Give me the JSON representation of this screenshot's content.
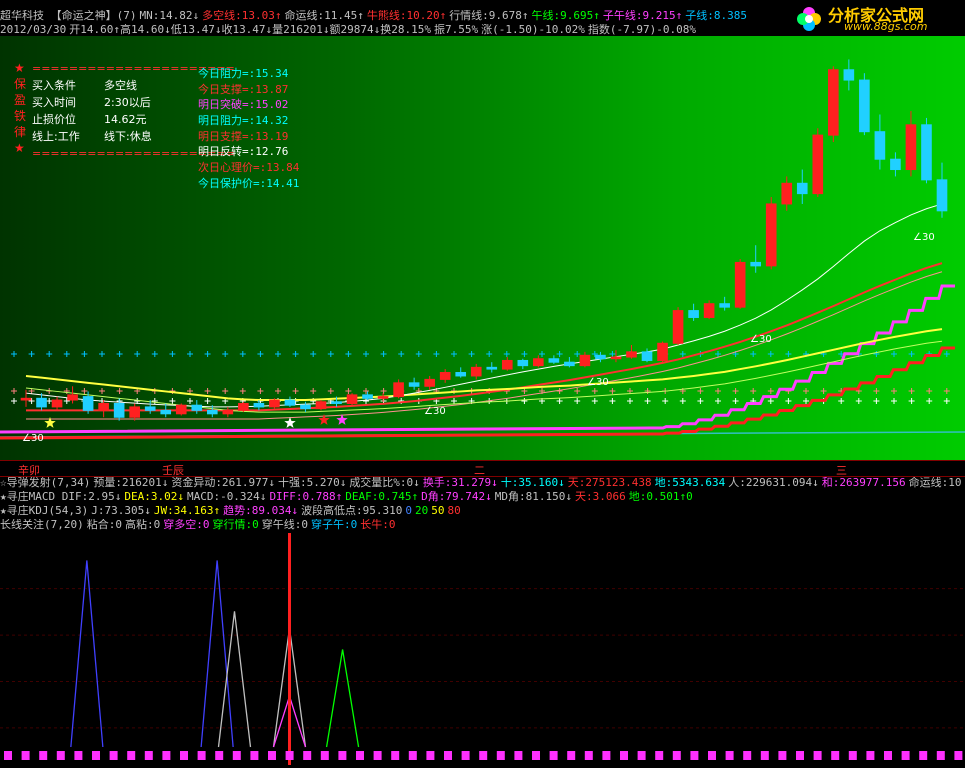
{
  "header": {
    "row1": [
      {
        "t": "超华科技 【命运之神】(7)",
        "c": "#c0c0c0"
      },
      {
        "t": "MN:14.82↓",
        "c": "#c0c0c0"
      },
      {
        "t": "多空线:13.03↑",
        "c": "#ff3030"
      },
      {
        "t": "命运线:11.45↑",
        "c": "#c0c0c0"
      },
      {
        "t": "牛熊线:10.20↑",
        "c": "#ff3030"
      },
      {
        "t": "行情线:9.678↑",
        "c": "#c0c0c0"
      },
      {
        "t": "午线:9.695↑",
        "c": "#00ff00"
      },
      {
        "t": "子午线:9.215↑",
        "c": "#ff40ff"
      },
      {
        "t": "子线:8.385",
        "c": "#00c0ff"
      }
    ],
    "row2": [
      {
        "t": "2012/03/30",
        "c": "#c0c0c0"
      },
      {
        "t": "开14.60↑高14.60↓低13.47↓收13.47↓量216201↓额29874↓换28.15%",
        "c": "#c0c0c0"
      },
      {
        "t": "振7.55%",
        "c": "#c0c0c0"
      },
      {
        "t": "涨(-1.50)-10.02%",
        "c": "#c0c0c0"
      },
      {
        "t": "指数(-7.97)-0.08%",
        "c": "#c0c0c0"
      }
    ]
  },
  "logo": {
    "title": "分析家公式网",
    "url": "www.88gs.com"
  },
  "info_panel": {
    "side_chars": [
      "★",
      "保",
      "盈",
      "铁",
      "律",
      "★"
    ],
    "lines": [
      {
        "a": "======================",
        "b": "",
        "c": "#ff3030"
      },
      {
        "a": "买入条件",
        "b": "多空线",
        "c": "#ffffff"
      },
      {
        "a": "买入时间",
        "b": "2:30以后",
        "c": "#ffffff"
      },
      {
        "a": "止损价位",
        "b": "14.62元",
        "c": "#ffffff"
      },
      {
        "a": "线上:工作",
        "b": "线下:休息",
        "c": "#ffffff"
      },
      {
        "a": "======================",
        "b": "",
        "c": "#ff3030"
      }
    ]
  },
  "levels": [
    {
      "t": "今日阻力=:15.34",
      "c": "#00ffff"
    },
    {
      "t": "今日支撑=:13.87",
      "c": "#ff3030"
    },
    {
      "t": "明日突破=:15.02",
      "c": "#ff40ff"
    },
    {
      "t": "明日阻力=:14.32",
      "c": "#00ffff"
    },
    {
      "t": "明日支撑=:13.19",
      "c": "#ff3030"
    },
    {
      "t": "明日反转=:12.76",
      "c": "#ffffff"
    },
    {
      "t": "次日心理价=:13.84",
      "c": "#ff3030"
    },
    {
      "t": "今日保护价=:14.41",
      "c": "#00ffff"
    }
  ],
  "angle_labels": [
    "∠30",
    "∠30",
    "∠30",
    "∠30",
    "∠30"
  ],
  "time_axis": {
    "labels": [
      "辛卯",
      "壬辰",
      "二",
      "三"
    ]
  },
  "indicators": [
    [
      {
        "t": "☆导弹发射(7,34)",
        "c": "#c0c0c0"
      },
      {
        "t": "预量:216201↓",
        "c": "#c0c0c0"
      },
      {
        "t": "资金异动:261.977↓",
        "c": "#c0c0c0"
      },
      {
        "t": "十强:5.270↓",
        "c": "#c0c0c0"
      },
      {
        "t": "成交量比%:0↓",
        "c": "#c0c0c0"
      },
      {
        "t": "换手:31.279↓",
        "c": "#ff40ff"
      },
      {
        "t": "十:35.160↓",
        "c": "#00ffff"
      },
      {
        "t": "天:275123.438",
        "c": "#ff3030"
      },
      {
        "t": "地:5343.634",
        "c": "#00ffff"
      },
      {
        "t": "人:229631.094↓",
        "c": "#c0c0c0"
      },
      {
        "t": "和:263977.156",
        "c": "#ff40ff"
      },
      {
        "t": "命运线:10",
        "c": "#c0c0c0"
      }
    ],
    [
      {
        "t": "★寻庄MACD DIF:2.95↓",
        "c": "#c0c0c0"
      },
      {
        "t": "DEA:3.02↓",
        "c": "#ffff00"
      },
      {
        "t": "MACD:-0.324↓",
        "c": "#c0c0c0"
      },
      {
        "t": "DIFF:0.788↑",
        "c": "#ff40ff"
      },
      {
        "t": "DEAF:0.745↑",
        "c": "#00ff00"
      },
      {
        "t": "D角:79.742↓",
        "c": "#ff40ff"
      },
      {
        "t": "MD角:81.150↓",
        "c": "#c0c0c0"
      },
      {
        "t": "天:3.066",
        "c": "#ff3030"
      },
      {
        "t": "地:0.501↑0",
        "c": "#00ff00"
      }
    ],
    [
      {
        "t": "★寻庄KDJ(54,3)",
        "c": "#c0c0c0"
      },
      {
        "t": "J:73.305↓",
        "c": "#c0c0c0"
      },
      {
        "t": "JW:34.163↑",
        "c": "#ffff00"
      },
      {
        "t": "趋势:89.034↓",
        "c": "#ff40ff"
      },
      {
        "t": "波段高低点:95.310",
        "c": "#c0c0c0"
      },
      {
        "t": "0",
        "c": "#4080ff"
      },
      {
        "t": "20",
        "c": "#00ff00"
      },
      {
        "t": "50",
        "c": "#ffff00"
      },
      {
        "t": "80",
        "c": "#ff3030"
      }
    ],
    [
      {
        "t": "长线关注(7,20)",
        "c": "#c0c0c0"
      },
      {
        "t": "粘合:0",
        "c": "#c0c0c0"
      },
      {
        "t": "高粘:0",
        "c": "#c0c0c0"
      },
      {
        "t": "穿多空:0",
        "c": "#ff40ff"
      },
      {
        "t": "穿行情:0",
        "c": "#00ff00"
      },
      {
        "t": "穿午线:0",
        "c": "#c0c0c0"
      },
      {
        "t": "穿子午:0",
        "c": "#00c0ff"
      },
      {
        "t": "长牛:0",
        "c": "#ff3030"
      }
    ]
  ],
  "chart_data": {
    "type": "candlestick",
    "candles": [
      {
        "o": 10.9,
        "h": 11.2,
        "l": 10.7,
        "c": 10.95
      },
      {
        "o": 10.95,
        "h": 11.1,
        "l": 10.6,
        "c": 10.7
      },
      {
        "o": 10.7,
        "h": 11.0,
        "l": 10.6,
        "c": 10.9
      },
      {
        "o": 10.9,
        "h": 11.3,
        "l": 10.8,
        "c": 11.05
      },
      {
        "o": 11.0,
        "h": 11.15,
        "l": 10.5,
        "c": 10.6
      },
      {
        "o": 10.6,
        "h": 10.9,
        "l": 10.4,
        "c": 10.8
      },
      {
        "o": 10.8,
        "h": 10.95,
        "l": 10.3,
        "c": 10.4
      },
      {
        "o": 10.4,
        "h": 10.8,
        "l": 10.3,
        "c": 10.7
      },
      {
        "o": 10.7,
        "h": 10.9,
        "l": 10.5,
        "c": 10.6
      },
      {
        "o": 10.6,
        "h": 10.8,
        "l": 10.4,
        "c": 10.5
      },
      {
        "o": 10.5,
        "h": 10.8,
        "l": 10.45,
        "c": 10.75
      },
      {
        "o": 10.75,
        "h": 10.9,
        "l": 10.5,
        "c": 10.6
      },
      {
        "o": 10.6,
        "h": 10.75,
        "l": 10.4,
        "c": 10.5
      },
      {
        "o": 10.5,
        "h": 10.7,
        "l": 10.4,
        "c": 10.6
      },
      {
        "o": 10.6,
        "h": 10.85,
        "l": 10.55,
        "c": 10.8
      },
      {
        "o": 10.8,
        "h": 10.9,
        "l": 10.6,
        "c": 10.7
      },
      {
        "o": 10.7,
        "h": 10.95,
        "l": 10.65,
        "c": 10.9
      },
      {
        "o": 10.9,
        "h": 11.0,
        "l": 10.7,
        "c": 10.75
      },
      {
        "o": 10.75,
        "h": 10.85,
        "l": 10.55,
        "c": 10.65
      },
      {
        "o": 10.65,
        "h": 10.9,
        "l": 10.6,
        "c": 10.85
      },
      {
        "o": 10.85,
        "h": 11.0,
        "l": 10.7,
        "c": 10.8
      },
      {
        "o": 10.8,
        "h": 11.1,
        "l": 10.75,
        "c": 11.05
      },
      {
        "o": 11.05,
        "h": 11.15,
        "l": 10.9,
        "c": 10.95
      },
      {
        "o": 10.95,
        "h": 11.1,
        "l": 10.85,
        "c": 11.0
      },
      {
        "o": 11.0,
        "h": 11.5,
        "l": 10.95,
        "c": 11.4
      },
      {
        "o": 11.4,
        "h": 11.55,
        "l": 11.2,
        "c": 11.3
      },
      {
        "o": 11.3,
        "h": 11.6,
        "l": 11.2,
        "c": 11.5
      },
      {
        "o": 11.5,
        "h": 11.8,
        "l": 11.4,
        "c": 11.7
      },
      {
        "o": 11.7,
        "h": 11.85,
        "l": 11.55,
        "c": 11.6
      },
      {
        "o": 11.6,
        "h": 11.95,
        "l": 11.5,
        "c": 11.85
      },
      {
        "o": 11.85,
        "h": 12.0,
        "l": 11.7,
        "c": 11.8
      },
      {
        "o": 11.8,
        "h": 12.15,
        "l": 11.75,
        "c": 12.05
      },
      {
        "o": 12.05,
        "h": 12.1,
        "l": 11.8,
        "c": 11.9
      },
      {
        "o": 11.9,
        "h": 12.2,
        "l": 11.85,
        "c": 12.1
      },
      {
        "o": 12.1,
        "h": 12.2,
        "l": 11.95,
        "c": 12.0
      },
      {
        "o": 12.0,
        "h": 12.15,
        "l": 11.85,
        "c": 11.9
      },
      {
        "o": 11.9,
        "h": 12.3,
        "l": 11.85,
        "c": 12.2
      },
      {
        "o": 12.2,
        "h": 12.3,
        "l": 12.0,
        "c": 12.1
      },
      {
        "o": 12.1,
        "h": 12.35,
        "l": 12.0,
        "c": 12.15
      },
      {
        "o": 12.15,
        "h": 12.5,
        "l": 12.1,
        "c": 12.3
      },
      {
        "o": 12.3,
        "h": 12.4,
        "l": 12.0,
        "c": 12.05
      },
      {
        "o": 12.05,
        "h": 12.6,
        "l": 12.0,
        "c": 12.55
      },
      {
        "o": 12.55,
        "h": 13.6,
        "l": 12.5,
        "c": 13.5
      },
      {
        "o": 13.5,
        "h": 13.7,
        "l": 13.2,
        "c": 13.3
      },
      {
        "o": 13.3,
        "h": 13.8,
        "l": 13.25,
        "c": 13.7
      },
      {
        "o": 13.7,
        "h": 13.9,
        "l": 13.5,
        "c": 13.6
      },
      {
        "o": 13.6,
        "h": 15.0,
        "l": 13.55,
        "c": 14.9
      },
      {
        "o": 14.9,
        "h": 15.4,
        "l": 14.6,
        "c": 14.8
      },
      {
        "o": 14.8,
        "h": 16.8,
        "l": 14.7,
        "c": 16.6
      },
      {
        "o": 16.6,
        "h": 17.4,
        "l": 16.4,
        "c": 17.2
      },
      {
        "o": 17.2,
        "h": 17.6,
        "l": 16.6,
        "c": 16.9
      },
      {
        "o": 16.9,
        "h": 18.8,
        "l": 16.8,
        "c": 18.6
      },
      {
        "o": 18.6,
        "h": 20.6,
        "l": 18.4,
        "c": 20.5
      },
      {
        "o": 20.5,
        "h": 20.8,
        "l": 19.9,
        "c": 20.2
      },
      {
        "o": 20.2,
        "h": 20.4,
        "l": 18.6,
        "c": 18.7
      },
      {
        "o": 18.7,
        "h": 19.2,
        "l": 17.6,
        "c": 17.9
      },
      {
        "o": 17.9,
        "h": 18.1,
        "l": 17.4,
        "c": 17.6
      },
      {
        "o": 17.6,
        "h": 19.3,
        "l": 17.4,
        "c": 18.9
      },
      {
        "o": 18.9,
        "h": 19.1,
        "l": 17.2,
        "c": 17.3
      },
      {
        "o": 17.3,
        "h": 17.8,
        "l": 16.2,
        "c": 16.4
      }
    ],
    "ma_yellow": [
      11.6,
      11.55,
      11.5,
      11.45,
      11.4,
      11.35,
      11.3,
      11.25,
      11.2,
      11.15,
      11.1,
      11.05,
      11.0,
      10.95,
      10.92,
      10.9,
      10.9,
      10.9,
      10.9,
      10.92,
      10.94,
      10.96,
      10.98,
      11.0,
      11.03,
      11.06,
      11.09,
      11.12,
      11.15,
      11.18,
      11.2,
      11.22,
      11.25,
      11.28,
      11.3,
      11.32,
      11.35,
      11.38,
      11.41,
      11.44,
      11.47,
      11.5,
      11.55,
      11.6,
      11.66,
      11.72,
      11.8,
      11.88,
      11.97,
      12.06,
      12.16,
      12.26,
      12.36,
      12.46,
      12.56,
      12.65,
      12.74,
      12.82,
      12.9,
      12.96
    ],
    "ma_white": [
      11.1,
      11.05,
      11.0,
      10.95,
      10.9,
      10.87,
      10.84,
      10.81,
      10.78,
      10.76,
      10.74,
      10.72,
      10.7,
      10.7,
      10.71,
      10.72,
      10.74,
      10.76,
      10.78,
      10.8,
      10.83,
      10.86,
      10.9,
      10.95,
      11.02,
      11.1,
      11.18,
      11.27,
      11.36,
      11.45,
      11.54,
      11.63,
      11.72,
      11.8,
      11.88,
      11.95,
      12.02,
      12.09,
      12.16,
      12.23,
      12.3,
      12.38,
      12.5,
      12.62,
      12.75,
      12.9,
      13.08,
      13.28,
      13.52,
      13.8,
      14.1,
      14.42,
      14.78,
      15.16,
      15.52,
      15.82,
      16.06,
      16.28,
      16.46,
      16.6
    ],
    "ma_red": [
      10.6,
      10.6,
      10.6,
      10.6,
      10.6,
      10.6,
      10.6,
      10.6,
      10.6,
      10.6,
      10.6,
      10.6,
      10.6,
      10.6,
      10.6,
      10.6,
      10.62,
      10.64,
      10.66,
      10.68,
      10.7,
      10.73,
      10.76,
      10.79,
      10.83,
      10.87,
      10.92,
      10.97,
      11.02,
      11.08,
      11.14,
      11.2,
      11.27,
      11.34,
      11.41,
      11.48,
      11.56,
      11.64,
      11.72,
      11.8,
      11.89,
      11.98,
      12.08,
      12.2,
      12.32,
      12.45,
      12.59,
      12.74,
      12.9,
      13.07,
      13.25,
      13.44,
      13.63,
      13.83,
      14.03,
      14.22,
      14.4,
      14.58,
      14.74,
      14.88
    ]
  },
  "lower_data": {
    "spikes": [
      {
        "pos": 0.09,
        "h": 0.88,
        "c": "#4040ff"
      },
      {
        "pos": 0.225,
        "h": 0.88,
        "c": "#4040ff"
      },
      {
        "pos": 0.243,
        "h": 0.64,
        "c": "#c0c0c0"
      },
      {
        "pos": 0.3,
        "h": 0.56,
        "c": "#c0c0c0"
      },
      {
        "pos": 0.3,
        "h": 0.24,
        "c": "#ff40ff"
      },
      {
        "pos": 0.355,
        "h": 0.46,
        "c": "#00ff00"
      }
    ],
    "marker_pos": 0.3
  }
}
